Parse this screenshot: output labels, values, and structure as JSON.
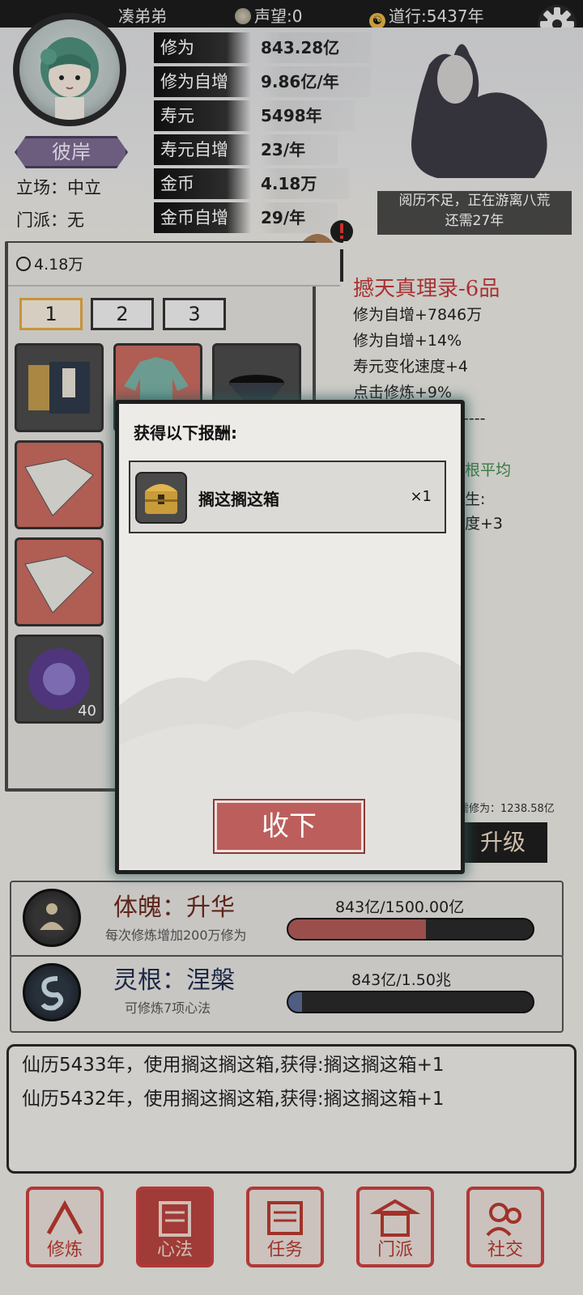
{
  "topbar": {
    "player_name": "凑弟弟",
    "reputation": "声望:0",
    "dao_year": "道行:5437年"
  },
  "profile": {
    "title_badge": "彼岸",
    "stance": "立场：中立",
    "sect": "门派：无"
  },
  "stats": [
    {
      "label": "修为",
      "value": "843.28亿"
    },
    {
      "label": "修为自增",
      "value": "9.86亿/年"
    },
    {
      "label": "寿元",
      "value": "5498年"
    },
    {
      "label": "寿元自增",
      "value": "23/年"
    },
    {
      "label": "金币",
      "value": "4.18万"
    },
    {
      "label": "金币自增",
      "value": "29/年"
    }
  ],
  "travel": {
    "line1": "阅历不足，正在游离八荒",
    "line2": "还需27年"
  },
  "inventory": {
    "coins": "4.18万",
    "tabs": [
      "1",
      "2",
      "3"
    ],
    "active_tab": 0,
    "slot_badge": "40"
  },
  "skill": {
    "title": "撼天真理录-6品",
    "lines": [
      "修为自增+7846万",
      "修为自增+14%",
      "寿元变化速度+4",
      "点击修炼+9%"
    ],
    "divider": "----",
    "partial1": "根平均",
    "partial2": "生:",
    "partial3": "度+3"
  },
  "upgrade": {
    "need_text": "需修为：1238.58亿",
    "button": "升级"
  },
  "body_card": {
    "title": "体魄：升华",
    "subtitle": "每次修炼增加200万修为",
    "progress_text": "843亿/1500.00亿",
    "progress": 0.562
  },
  "root_card": {
    "title": "灵根：涅槃",
    "subtitle": "可修炼7项心法",
    "progress_text": "843亿/1.50兆",
    "progress": 0.056
  },
  "log": [
    "仙历5433年，使用搁这搁这箱,获得:搁这搁这箱+1",
    "仙历5432年，使用搁这搁这箱,获得:搁这搁这箱+1"
  ],
  "nav": [
    {
      "label": "修炼"
    },
    {
      "label": "心法"
    },
    {
      "label": "任务"
    },
    {
      "label": "门派"
    },
    {
      "label": "社交"
    }
  ],
  "modal": {
    "title": "获得以下报酬:",
    "reward_name": "搁这搁这箱",
    "reward_count": "×1",
    "button": "收下"
  },
  "colors": {
    "accent_red": "#c0393b",
    "body_fill": "#b05a58",
    "root_fill": "#5a6a93",
    "badge_purple": "#7b6a91"
  }
}
